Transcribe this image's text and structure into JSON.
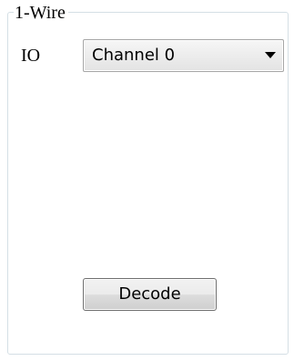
{
  "group": {
    "title": "1-Wire"
  },
  "io": {
    "label": "IO",
    "selected": "Channel 0"
  },
  "actions": {
    "decode_label": "Decode"
  }
}
